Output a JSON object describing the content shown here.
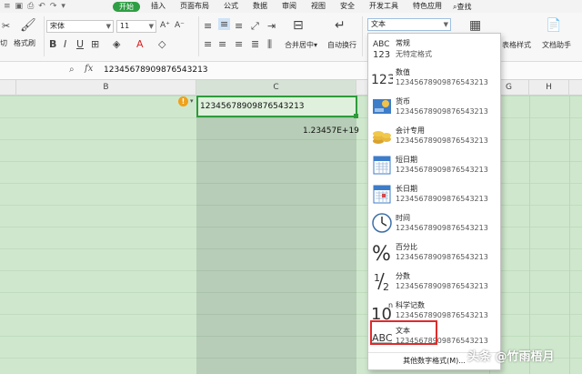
{
  "menubar": {
    "tabs": [
      "开始",
      "插入",
      "页面布局",
      "公式",
      "数据",
      "审阅",
      "视图",
      "安全",
      "开发工具",
      "特色应用"
    ],
    "active_tab": "开始",
    "search_label": "查找"
  },
  "ribbon": {
    "cut_label": "切",
    "format_painter_label": "格式刷",
    "font_name": "宋体",
    "font_size": "11",
    "merge_label": "合并居中",
    "wrap_label": "自动换行",
    "number_format": "文本",
    "table_style_label": "表格样式",
    "doc_helper_label": "文档助手"
  },
  "formula_bar": {
    "fx_label": "fx",
    "value": "12345678909876543213"
  },
  "columns": [
    "B",
    "C",
    "G",
    "H"
  ],
  "cells": {
    "active_text": "12345678909876543213",
    "sci_value": "1.23457E+19"
  },
  "dropdown": {
    "items": [
      {
        "title": "常规",
        "sample": "无特定格式",
        "icon": "abc-123-icon"
      },
      {
        "title": "数值",
        "sample": "12345678909876543213",
        "icon": "number-123-icon"
      },
      {
        "title": "货币",
        "sample": "12345678909876543213",
        "icon": "currency-icon"
      },
      {
        "title": "会计专用",
        "sample": "12345678909876543213",
        "icon": "accounting-coins-icon"
      },
      {
        "title": "短日期",
        "sample": "12345678909876543213",
        "icon": "calendar-icon"
      },
      {
        "title": "长日期",
        "sample": "12345678909876543213",
        "icon": "calendar-long-icon"
      },
      {
        "title": "时间",
        "sample": "12345678909876543213",
        "icon": "clock-icon"
      },
      {
        "title": "百分比",
        "sample": "12345678909876543213",
        "icon": "percent-icon"
      },
      {
        "title": "分数",
        "sample": "12345678909876543213",
        "icon": "fraction-icon"
      },
      {
        "title": "科学记数",
        "sample": "12345678909876543213",
        "icon": "scientific-icon"
      },
      {
        "title": "文本",
        "sample": "12345678909876543213",
        "icon": "text-abc-icon"
      }
    ],
    "footer": "其他数字格式(M)..."
  },
  "watermark": "头条 @竹雨梧月",
  "colors": {
    "accent": "#2f9e44",
    "highlight": "#e02a2a",
    "grid": "#cfe8cd"
  }
}
